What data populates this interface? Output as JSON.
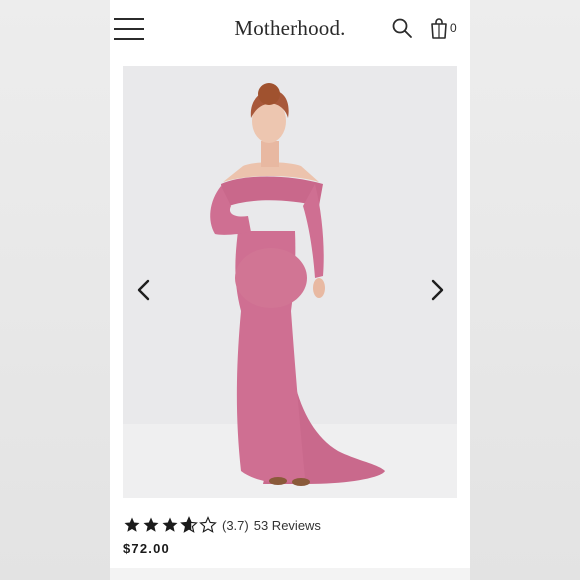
{
  "header": {
    "brand": "Motherhood.",
    "cart_count": "0",
    "icons": {
      "menu": "hamburger-menu-icon",
      "search": "search-icon",
      "cart": "shopping-bag-icon"
    }
  },
  "gallery": {
    "image_description_icon": "product-photo",
    "prev_icon": "chevron-left-icon",
    "next_icon": "chevron-right-icon"
  },
  "product": {
    "rating_value": 3.7,
    "rating_text": "(3.7)",
    "reviews_text": "53 Reviews",
    "price": "$72.00"
  },
  "colors": {
    "dress": "#cf6f92",
    "dress_shadow": "#b95a7e",
    "background": "#e9e9eb",
    "text": "#2a2a2a"
  }
}
